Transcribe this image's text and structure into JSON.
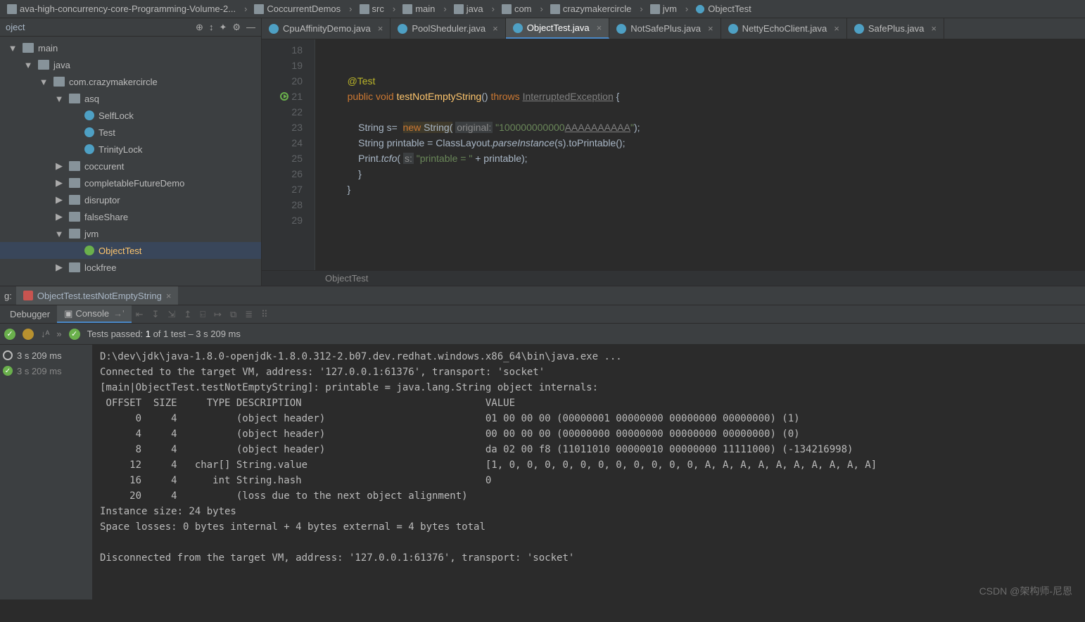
{
  "breadcrumb": [
    {
      "icon": "folder",
      "label": "ava-high-concurrency-core-Programming-Volume-2..."
    },
    {
      "icon": "folder",
      "label": "CoccurrentDemos"
    },
    {
      "icon": "folder",
      "label": "src"
    },
    {
      "icon": "folder",
      "label": "main"
    },
    {
      "icon": "folder",
      "label": "java"
    },
    {
      "icon": "folder",
      "label": "com"
    },
    {
      "icon": "folder",
      "label": "crazymakercircle"
    },
    {
      "icon": "folder",
      "label": "jvm"
    },
    {
      "icon": "class",
      "label": "ObjectTest"
    }
  ],
  "project": {
    "title": "oject",
    "tools": [
      "⊕",
      "↕",
      "✦",
      "⚙",
      "—"
    ],
    "tree": [
      {
        "depth": 0,
        "arrow": "▼",
        "icon": "folder",
        "label": "main"
      },
      {
        "depth": 1,
        "arrow": "▼",
        "icon": "folder",
        "label": "java"
      },
      {
        "depth": 2,
        "arrow": "▼",
        "icon": "pkg",
        "label": "com.crazymakercircle"
      },
      {
        "depth": 3,
        "arrow": "▼",
        "icon": "pkg",
        "label": "asq"
      },
      {
        "depth": 4,
        "arrow": "",
        "icon": "class",
        "label": "SelfLock"
      },
      {
        "depth": 4,
        "arrow": "",
        "icon": "class",
        "label": "Test"
      },
      {
        "depth": 4,
        "arrow": "",
        "icon": "class",
        "label": "TrinityLock"
      },
      {
        "depth": 3,
        "arrow": "▶",
        "icon": "pkg",
        "label": "coccurent"
      },
      {
        "depth": 3,
        "arrow": "▶",
        "icon": "pkg",
        "label": "completableFutureDemo"
      },
      {
        "depth": 3,
        "arrow": "▶",
        "icon": "pkg",
        "label": "disruptor"
      },
      {
        "depth": 3,
        "arrow": "▶",
        "icon": "pkg",
        "label": "falseShare"
      },
      {
        "depth": 3,
        "arrow": "▼",
        "icon": "pkg",
        "label": "jvm"
      },
      {
        "depth": 4,
        "arrow": "",
        "icon": "test",
        "label": "ObjectTest",
        "selected": true
      },
      {
        "depth": 3,
        "arrow": "▶",
        "icon": "pkg",
        "label": "lockfree"
      }
    ]
  },
  "tabs": [
    {
      "label": "CpuAffinityDemo.java"
    },
    {
      "label": "PoolSheduler.java"
    },
    {
      "label": "ObjectTest.java",
      "active": true
    },
    {
      "label": "NotSafePlus.java"
    },
    {
      "label": "NettyEchoClient.java"
    },
    {
      "label": "SafePlus.java"
    }
  ],
  "code": {
    "lines": [
      {
        "n": 18,
        "html": ""
      },
      {
        "n": 19,
        "html": ""
      },
      {
        "n": 20,
        "html": "    <span class='an'>@Test</span>"
      },
      {
        "n": 21,
        "run": true,
        "html": "    <span class='k'>public void</span> <span class='m'>testNotEmptyString</span>() <span class='k'>throws</span> <span class='ul'>InterruptedException</span> {"
      },
      {
        "n": 22,
        "html": ""
      },
      {
        "n": 23,
        "html": "        String s=  <span class='nw'><span class='k'>new</span> String(</span> <span class='hint'>original:</span> <span class='s'>\"100000000000<span class='ul'>AAAAAAAAAA</span>\"</span>);"
      },
      {
        "n": 24,
        "html": "        String printable = ClassLayout.<span class='em'>parseInstance</span>(s).toPrintable();"
      },
      {
        "n": 25,
        "html": "        Print.<span class='em'>tcfo</span>( <span class='hint'>s:</span> <span class='s'>\"printable = \"</span> + printable);"
      },
      {
        "n": 26,
        "html": "        }"
      },
      {
        "n": 27,
        "html": "    }"
      },
      {
        "n": 28,
        "html": ""
      },
      {
        "n": 29,
        "html": ""
      }
    ],
    "foot": "ObjectTest"
  },
  "run": {
    "label": "g:",
    "config": "ObjectTest.testNotEmptyString",
    "debugger": "Debugger",
    "console": "Console",
    "tests_summary": {
      "pre": "Tests passed: ",
      "bold": "1",
      "post": " of 1 test – 3 s 209 ms"
    },
    "side": [
      {
        "icon": "ring",
        "label": "3 s 209 ms"
      },
      {
        "icon": "chk",
        "label": "3 s 209 ms",
        "dim": true
      }
    ],
    "console_lines": [
      "D:\\dev\\jdk\\java-1.8.0-openjdk-1.8.0.312-2.b07.dev.redhat.windows.x86_64\\bin\\java.exe ...",
      "Connected to the target VM, address: '127.0.0.1:61376', transport: 'socket'",
      "[main|ObjectTest.testNotEmptyString]: printable = java.lang.String object internals:",
      " OFFSET  SIZE     TYPE DESCRIPTION                               VALUE",
      "      0     4          (object header)                           01 00 00 00 (00000001 00000000 00000000 00000000) (1)",
      "      4     4          (object header)                           00 00 00 00 (00000000 00000000 00000000 00000000) (0)",
      "      8     4          (object header)                           da 02 00 f8 (11011010 00000010 00000000 11111000) (-134216998)",
      "     12     4   char[] String.value                              [1, 0, 0, 0, 0, 0, 0, 0, 0, 0, 0, 0, A, A, A, A, A, A, A, A, A, A]",
      "     16     4      int String.hash                               0",
      "     20     4          (loss due to the next object alignment)",
      "Instance size: 24 bytes",
      "Space losses: 0 bytes internal + 4 bytes external = 4 bytes total",
      "",
      "Disconnected from the target VM, address: '127.0.0.1:61376', transport: 'socket'"
    ]
  },
  "watermark": "CSDN @架构师-尼恩"
}
